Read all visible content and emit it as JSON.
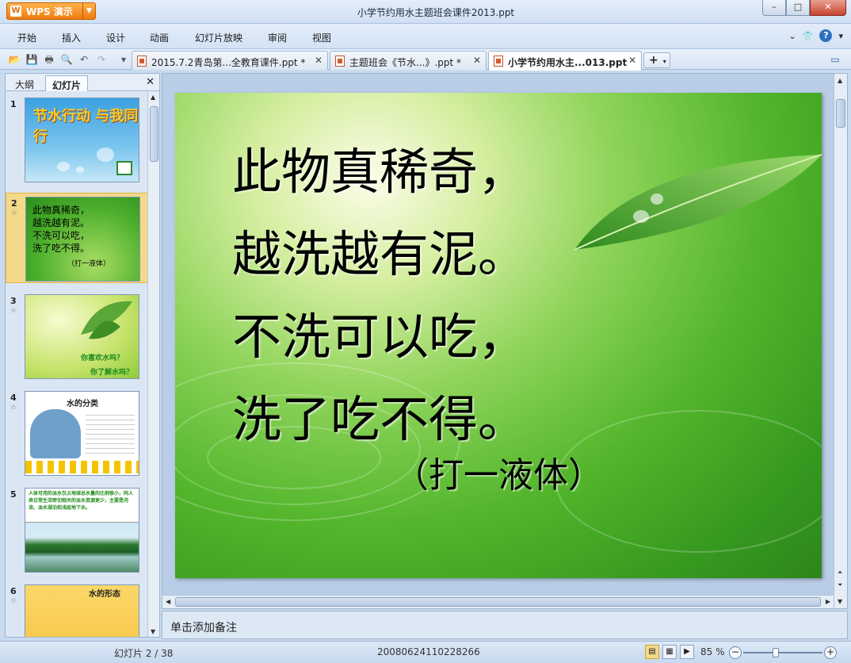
{
  "app": {
    "name": "WPS 演示",
    "logo": "W"
  },
  "window": {
    "title": "小学节约用水主题班会课件2013.ppt"
  },
  "menu": [
    "开始",
    "插入",
    "设计",
    "动画",
    "幻灯片放映",
    "审阅",
    "视图"
  ],
  "tabs": [
    {
      "label": "2015.7.2青岛第...全教育课件.ppt *",
      "active": false
    },
    {
      "label": "主题班会《节水...》.ppt *",
      "active": false
    },
    {
      "label": "小学节约用水主...013.ppt",
      "active": true
    }
  ],
  "left_panel": {
    "tabs": [
      "大纲",
      "幻灯片"
    ],
    "slides": [
      {
        "num": "1",
        "title": "节水行动 与我同行"
      },
      {
        "num": "2",
        "lines": [
          "此物真稀奇，",
          "越洗越有泥。",
          "不洗可以吃，",
          "洗了吃不得。"
        ],
        "hint": "（打一液体）"
      },
      {
        "num": "3",
        "q1": "你喜欢水吗？",
        "q2": "你了解水吗？"
      },
      {
        "num": "4",
        "title": "水的分类"
      },
      {
        "num": "5",
        "text": "人体可用的淡水仅占地球总水量的比例很小，同人类日常生活密切相关的淡水资源更少，主要是河流、淡水湖泊和浅层地下水。"
      },
      {
        "num": "6",
        "title": "水的形态"
      }
    ]
  },
  "slide": {
    "lines": [
      "此物真稀奇，",
      "越洗越有泥。",
      "不洗可以吃，",
      "洗了吃不得。"
    ],
    "hint": "（打一液体）"
  },
  "notes": {
    "placeholder": "单击添加备注"
  },
  "status": {
    "slide_counter": "幻灯片 2 / 38",
    "template_id": "20080624110228266",
    "zoom": "85 %"
  },
  "colors": {
    "accent": "#f07a10",
    "chrome": "#d3e2f4",
    "selection": "#f5d98a"
  }
}
